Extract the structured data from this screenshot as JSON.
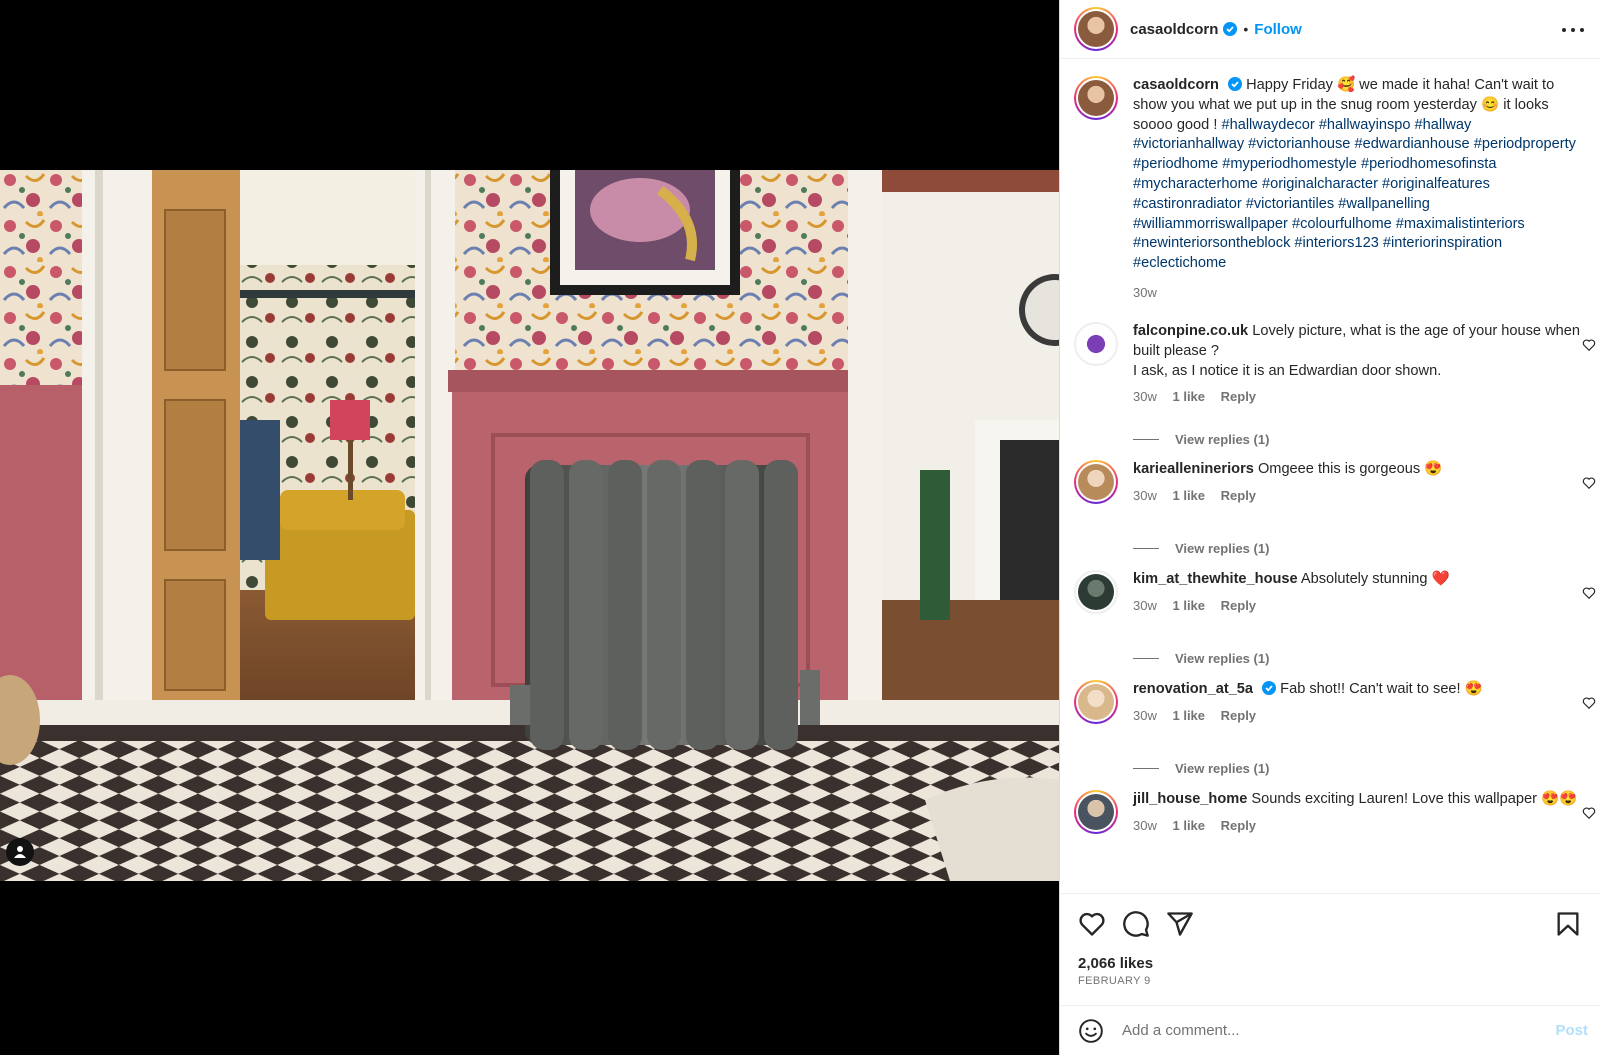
{
  "post": {
    "username": "casaoldcorn",
    "follow_label": "Follow",
    "separator": "•",
    "caption_text": "Happy Friday 🥰 we made it haha! Can't wait to show you what we put up in the snug room yesterday 😊 it looks soooo good !",
    "caption_tags": "#hallwaydecor #hallwayinspo #hallway #victorianhallway #victorianhouse #edwardianhouse #periodproperty #periodhome #myperiodhomestyle #periodhomesofinsta #mycharacterhome #originalcharacter #originalfeatures #castironradiator #victoriantiles #wallpanelling #williammorriswallpaper #colourfulhome #maximalistinteriors #newinteriorsontheblock #interiors123 #interiorinspiration #eclectichome",
    "caption_age": "30w",
    "likes": "2,066 likes",
    "date": "FEBRUARY 9"
  },
  "comments": [
    {
      "username": "falconpine.co.uk",
      "text": "Lovely picture, what is the age of your house when built please ?",
      "text2": "I ask, as I notice it is an Edwardian door shown.",
      "age": "30w",
      "likes": "1 like",
      "reply": "Reply",
      "view_replies": "View replies (1)"
    },
    {
      "username": "karieallenineriors",
      "text": "Omgeee this is gorgeous 😍",
      "age": "30w",
      "likes": "1 like",
      "reply": "Reply",
      "view_replies": "View replies (1)"
    },
    {
      "username": "kim_at_thewhite_house",
      "text": "Absolutely stunning ❤️",
      "age": "30w",
      "likes": "1 like",
      "reply": "Reply",
      "view_replies": "View replies (1)"
    },
    {
      "username": "renovation_at_5a",
      "text": "Fab shot!! Can't wait to see! 😍",
      "age": "30w",
      "likes": "1 like",
      "reply": "Reply",
      "view_replies": "View replies (1)"
    },
    {
      "username": "jill_house_home",
      "text": "Sounds exciting Lauren! Love this wallpaper 😍😍",
      "age": "30w",
      "likes": "1 like",
      "reply": "Reply"
    }
  ],
  "composer": {
    "placeholder": "Add a comment...",
    "post_label": "Post"
  },
  "icons": {
    "more": "more-options-icon",
    "like": "heart-icon",
    "comment": "comment-icon",
    "share": "share-icon",
    "save": "bookmark-icon",
    "emoji": "emoji-icon",
    "tag": "user-tag-icon",
    "verified": "verified-badge-icon"
  },
  "colors": {
    "accent": "#0095f6",
    "hashtag": "#00376b",
    "muted": "#737373",
    "post_disabled": "#b2dffc"
  }
}
